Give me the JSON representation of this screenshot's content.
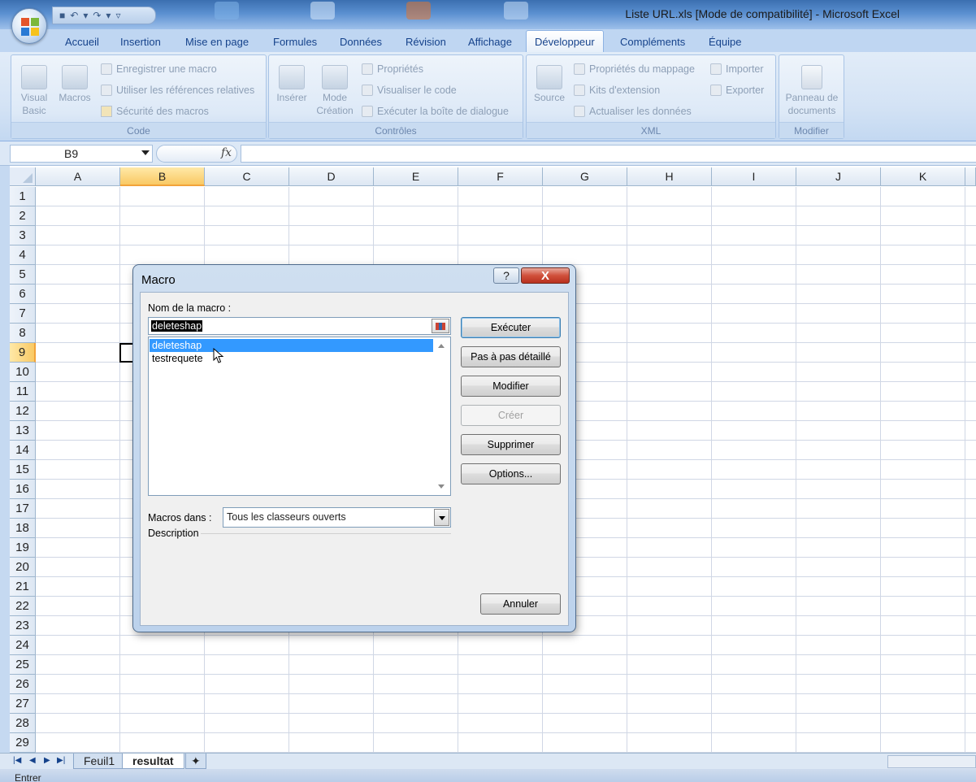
{
  "window": {
    "title": "Liste URL.xls  [Mode de compatibilité] - Microsoft Excel"
  },
  "ribbon": {
    "tabs": [
      "Accueil",
      "Insertion",
      "Mise en page",
      "Formules",
      "Données",
      "Révision",
      "Affichage",
      "Développeur",
      "Compléments",
      "Équipe"
    ],
    "active_tab": "Développeur",
    "groups": {
      "code": {
        "label": "Code",
        "visual_basic": "Visual Basic",
        "macros": "Macros",
        "record_macro": "Enregistrer une macro",
        "relative_refs": "Utiliser les références relatives",
        "macro_security": "Sécurité des macros"
      },
      "controls": {
        "label": "Contrôles",
        "insert": "Insérer",
        "design_mode": "Mode Création",
        "properties": "Propriétés",
        "view_code": "Visualiser le code",
        "run_dialog": "Exécuter la boîte de dialogue"
      },
      "xml": {
        "label": "XML",
        "source": "Source",
        "map_properties": "Propriétés du mappage",
        "expansion_packs": "Kits d'extension",
        "refresh_data": "Actualiser les données",
        "import": "Importer",
        "export": "Exporter"
      },
      "modify": {
        "label": "Modifier",
        "document_panel": "Panneau de documents"
      }
    }
  },
  "formula_bar": {
    "name_box": "B9",
    "fx": "fx",
    "value": ""
  },
  "grid": {
    "columns": [
      "A",
      "B",
      "C",
      "D",
      "E",
      "F",
      "G",
      "H",
      "I",
      "J",
      "K"
    ],
    "rows": [
      "1",
      "2",
      "3",
      "4",
      "5",
      "6",
      "7",
      "8",
      "9",
      "10",
      "11",
      "12",
      "13",
      "14",
      "15",
      "16",
      "17",
      "18",
      "19",
      "20",
      "21",
      "22",
      "23",
      "24",
      "25",
      "26",
      "27",
      "28",
      "29"
    ],
    "selected_column": "B",
    "selected_row": "9"
  },
  "sheets": {
    "tabs": [
      "Feuil1",
      "resultat"
    ],
    "active": "resultat"
  },
  "status": {
    "mode": "Entrer"
  },
  "dialog": {
    "title": "Macro",
    "help": "?",
    "close": "X",
    "macro_name_label": "Nom de la macro :",
    "macro_name_value": "deleteshap",
    "macros_list": [
      "deleteshap",
      "testrequete"
    ],
    "selected_macro": "deleteshap",
    "macros_in_label": "Macros dans :",
    "macros_in_value": "Tous les classeurs ouverts",
    "description_label": "Description",
    "buttons": {
      "run": "Exécuter",
      "step_into": "Pas à pas détaillé",
      "edit": "Modifier",
      "create": "Créer",
      "delete": "Supprimer",
      "options": "Options...",
      "cancel": "Annuler"
    }
  }
}
